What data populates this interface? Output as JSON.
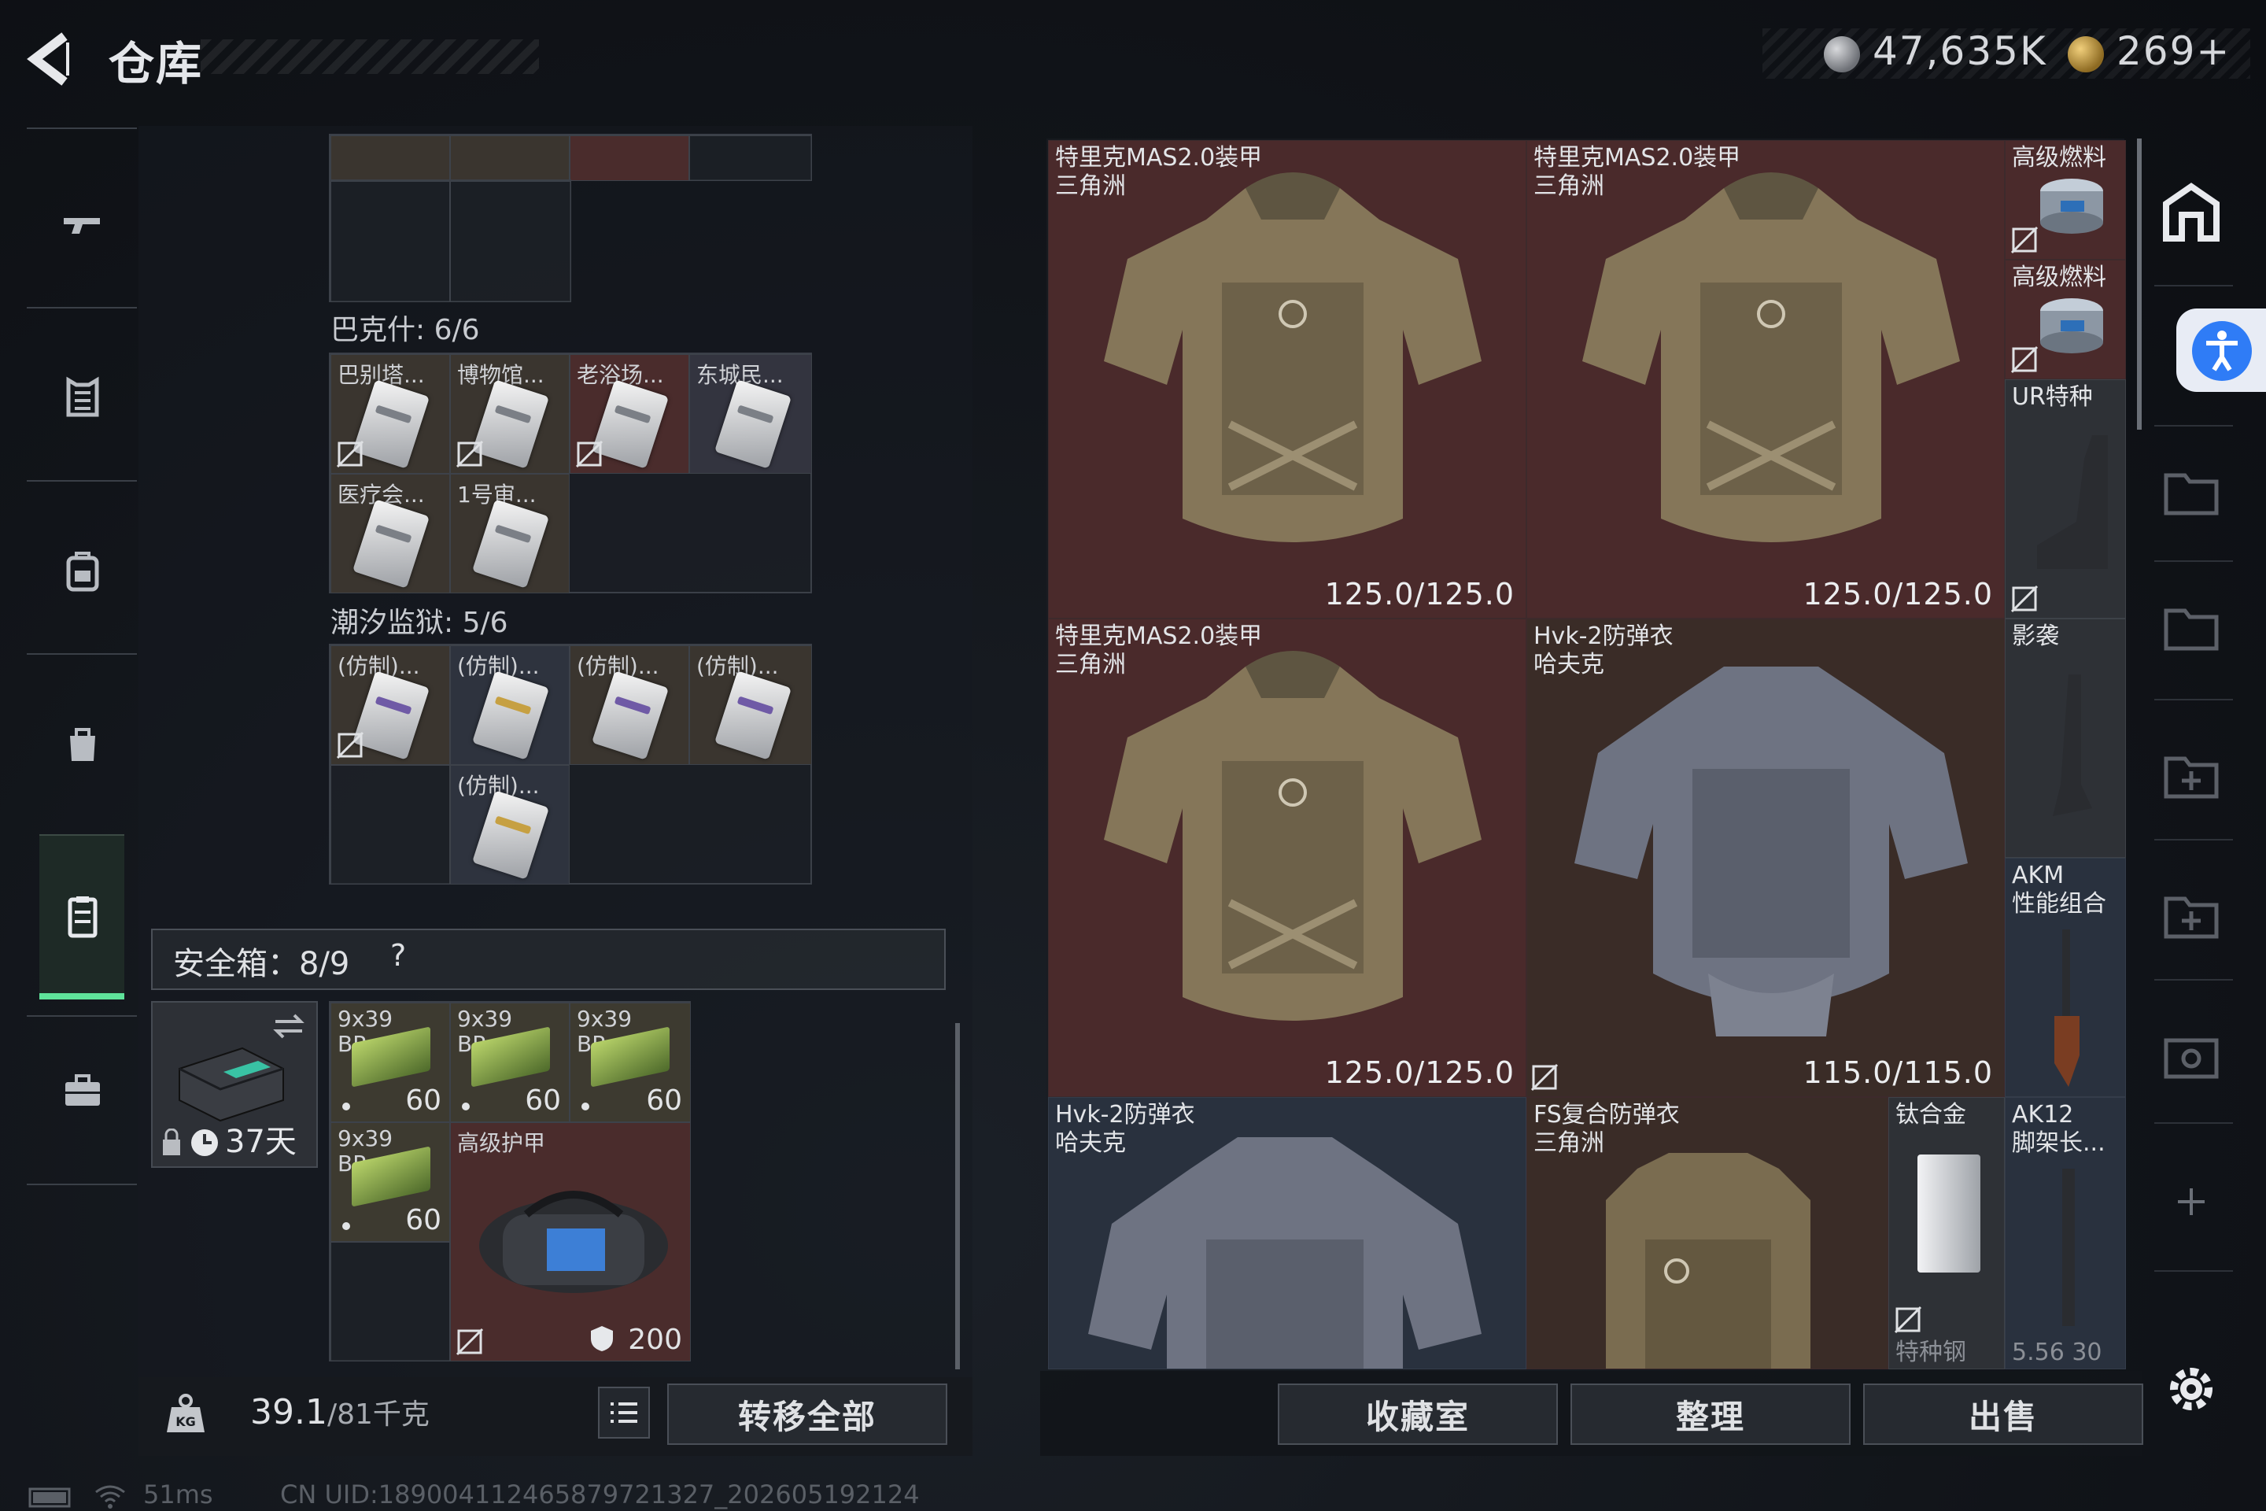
{
  "header": {
    "title": "仓库"
  },
  "currency": {
    "silver": "47,635K",
    "gold": "269+"
  },
  "nav": {
    "items": [
      "weapon-icon",
      "armor-icon",
      "backpack-icon",
      "bag-icon",
      "container-icon",
      "briefcase-icon"
    ],
    "active": "container-icon"
  },
  "container": {
    "groups": [
      {
        "label": "巴克什: 6/6",
        "keys": [
          "巴别塔...",
          "博物馆...",
          "老浴场...",
          "东城民...",
          "医疗会...",
          "1号审..."
        ]
      },
      {
        "label": "潮汐监狱: 5/6",
        "keys": [
          "(仿制)...",
          "(仿制)...",
          "(仿制)...",
          "(仿制)...",
          "(仿制)..."
        ]
      }
    ],
    "safe_box": {
      "label": "安全箱：8/9",
      "help": "?",
      "days": "37天",
      "ammo": [
        {
          "name": "9x39\nBP",
          "count": "60"
        },
        {
          "name": "9x39\nBP",
          "count": "60"
        },
        {
          "name": "9x39\nBP",
          "count": "60"
        },
        {
          "name": "9x39\nBP",
          "count": "60"
        }
      ],
      "bag": {
        "name": "高级护甲",
        "value": "200"
      }
    },
    "weight": {
      "value": "39.1",
      "unit": "/81千克"
    },
    "transfer_all": "转移全部"
  },
  "warehouse": {
    "items": [
      {
        "name1": "特里克MAS2.0装甲",
        "name2": "三角洲",
        "durability": "125.0/125.0"
      },
      {
        "name1": "特里克MAS2.0装甲",
        "name2": "三角洲",
        "durability": "125.0/125.0"
      },
      {
        "name1": "特里克MAS2.0装甲",
        "name2": "三角洲",
        "durability": "125.0/125.0"
      },
      {
        "name1": "Hvk-2防弹衣",
        "name2": "哈夫克",
        "durability": "115.0/115.0"
      },
      {
        "name1": "Hvk-2防弹衣",
        "name2": "哈夫克",
        "durability": ""
      },
      {
        "name1": "FS复合防弹衣",
        "name2": "三角洲",
        "durability": ""
      }
    ],
    "small": [
      {
        "name1": "高级燃料",
        "name2": ""
      },
      {
        "name1": "高级燃料",
        "name2": ""
      },
      {
        "name1": "UR特种",
        "name2": ""
      },
      {
        "name1": "影袭",
        "name2": ""
      },
      {
        "name1": "AKM",
        "name2": "性能组合"
      },
      {
        "name1": "钛合金",
        "name2": "特种钢"
      },
      {
        "name1": "AK12",
        "name2": "脚架长...",
        "name3": "5.56 30"
      }
    ],
    "actions": [
      "收藏室",
      "整理",
      "出售"
    ]
  },
  "status": {
    "ping": "51ms",
    "uid": "CN UID:189004112465879721327_202605192124"
  }
}
